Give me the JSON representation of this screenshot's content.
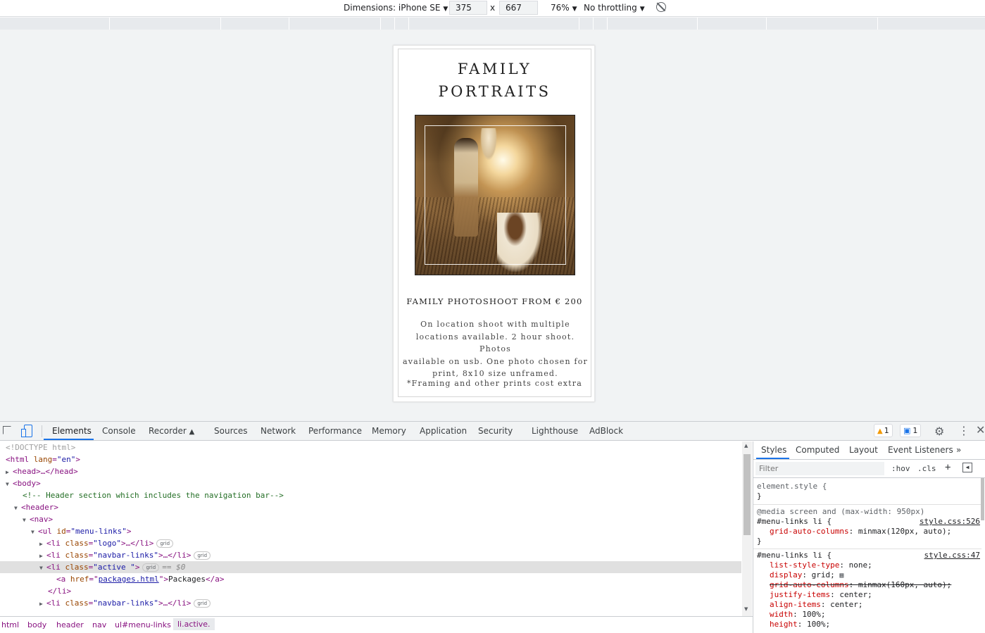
{
  "device_toolbar": {
    "dimensions_label": "Dimensions: iPhone SE",
    "width": "375",
    "times": "x",
    "height": "667",
    "zoom": "76%",
    "throttling": "No throttling"
  },
  "page": {
    "title_line1": "FAMILY",
    "title_line2": "PORTRAITS",
    "subheading": "FAMILY PHOTOSHOOT FROM € 200",
    "description_lines": [
      "On location shoot with multiple",
      "locations available. 2 hour shoot. Photos",
      "available on usb. One photo chosen for",
      "print, 8x10 size unframed."
    ],
    "note": "*Framing and other prints cost extra"
  },
  "devtools": {
    "tabs": [
      "Elements",
      "Console",
      "Recorder",
      "Sources",
      "Network",
      "Performance",
      "Memory",
      "Application",
      "Security",
      "Lighthouse",
      "AdBlock"
    ],
    "warnings_count": "1",
    "messages_count": "1",
    "dom": {
      "doctype": "<!DOCTYPE html>",
      "html_open": "<html",
      "lang_attr": "lang",
      "lang_val": "\"en\"",
      "head": "<head>…</head>",
      "body_open": "<body>",
      "comment": "<!-- Header section which includes the navigation bar-->",
      "header_open": "<header>",
      "nav_open": "<nav>",
      "ul_tag": "<ul",
      "ul_attr": "id",
      "ul_val": "\"menu-links\"",
      "li_tag": "<li",
      "class_attr": "class",
      "logo_val": "\"logo\"",
      "navbar_val": "\"navbar-links\"",
      "active_val": "\"active \"",
      "collapsed_end": ">…</li>",
      "grid_pill": "grid",
      "selected_marker": "== $0",
      "a_tag": "<a",
      "href_attr": "href",
      "href_val": "packages.html",
      "link_text": "Packages",
      "a_close": "</a>",
      "li_close": "</li>"
    },
    "breadcrumbs": [
      "html",
      "body",
      "header",
      "nav",
      "ul#menu-links",
      "li.active."
    ],
    "styles_tabs": [
      "Styles",
      "Computed",
      "Layout",
      "Event Listeners"
    ],
    "filter_placeholder": "Filter",
    "hov": ":hov",
    "cls": ".cls",
    "rules": {
      "element_style": "element.style {",
      "close_brace": "}",
      "media": "@media screen and (max-width: 950px)",
      "menu_sel": "#menu-links li {",
      "source1": "style.css:526",
      "src2": "style.css:47",
      "p_grid_auto": "grid-auto-columns",
      "v_grid_auto": "minmax(120px, auto);",
      "p_list": "list-style-type",
      "v_list": "none;",
      "p_display": "display",
      "v_display": "grid;",
      "p_grid_auto_struck": "grid-auto-columns",
      "v_grid_auto_struck": "minmax(160px, auto);",
      "p_justify": "justify-items",
      "v_justify": "center;",
      "p_align": "align-items",
      "v_align": "center;",
      "p_width": "width",
      "v_width": "100%;",
      "p_height": "height",
      "v_height": "100%;"
    }
  }
}
